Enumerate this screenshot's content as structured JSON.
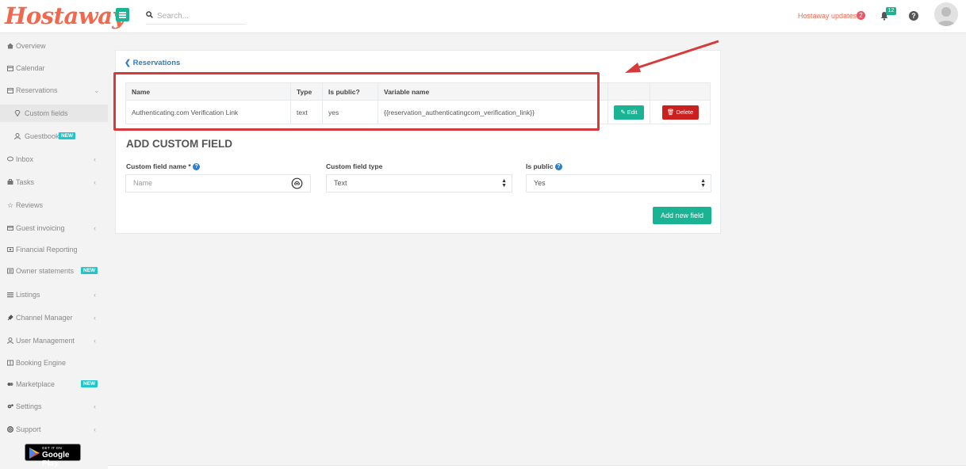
{
  "brand": {
    "logo": "Hostaway",
    "accent": "#1ab394",
    "brand_color": "#f0684e",
    "danger": "#cc1f1f",
    "highlight": "#d63a3a"
  },
  "topbar": {
    "search_placeholder": "Search...",
    "updates_label": "Hostaway updates",
    "updates_count": "2",
    "notifications_count": "12",
    "help": "?"
  },
  "sidebar": {
    "items": [
      {
        "label": "Overview",
        "icon": "home-icon"
      },
      {
        "label": "Calendar",
        "icon": "calendar-icon"
      },
      {
        "label": "Reservations",
        "icon": "calendar-check-icon",
        "expanded": true
      },
      {
        "label": "Custom fields",
        "icon": "diamond-icon",
        "active": true
      },
      {
        "label": "Guestbook",
        "icon": "user-icon",
        "badge": "NEW"
      },
      {
        "label": "Inbox",
        "icon": "chat-icon"
      },
      {
        "label": "Tasks",
        "icon": "briefcase-icon"
      },
      {
        "label": "Reviews",
        "icon": "star-icon"
      },
      {
        "label": "Guest invoicing",
        "icon": "credit-card-icon"
      },
      {
        "label": "Financial Reporting",
        "icon": "money-icon"
      },
      {
        "label": "Owner statements",
        "icon": "statement-icon",
        "badge": "NEW"
      },
      {
        "label": "Listings",
        "icon": "list-icon"
      },
      {
        "label": "Channel Manager",
        "icon": "plug-icon"
      },
      {
        "label": "User Management",
        "icon": "user-icon"
      },
      {
        "label": "Booking Engine",
        "icon": "book-icon"
      },
      {
        "label": "Marketplace",
        "icon": "handshake-icon",
        "badge": "NEW"
      },
      {
        "label": "Settings",
        "icon": "cogs-icon"
      },
      {
        "label": "Support",
        "icon": "life-ring-icon"
      }
    ],
    "google_play": {
      "small": "GET IT ON",
      "big": "Google Play"
    }
  },
  "main": {
    "back_label": "Reservations",
    "table": {
      "headers": [
        "Name",
        "Type",
        "Is public?",
        "Variable name"
      ],
      "rows": [
        {
          "name": "Authenticating.com Verification Link",
          "type": "text",
          "is_public": "yes",
          "variable": "{{reservation_authenticatingcom_verification_link}}",
          "edit_label": "Edit",
          "delete_label": "Delete"
        }
      ]
    },
    "add_section": {
      "title": "ADD CUSTOM FIELD",
      "name_label": "Custom field name *",
      "name_placeholder": "Name",
      "type_label": "Custom field type",
      "type_value": "Text",
      "public_label": "Is public",
      "public_value": "Yes",
      "submit_label": "Add new field"
    }
  }
}
